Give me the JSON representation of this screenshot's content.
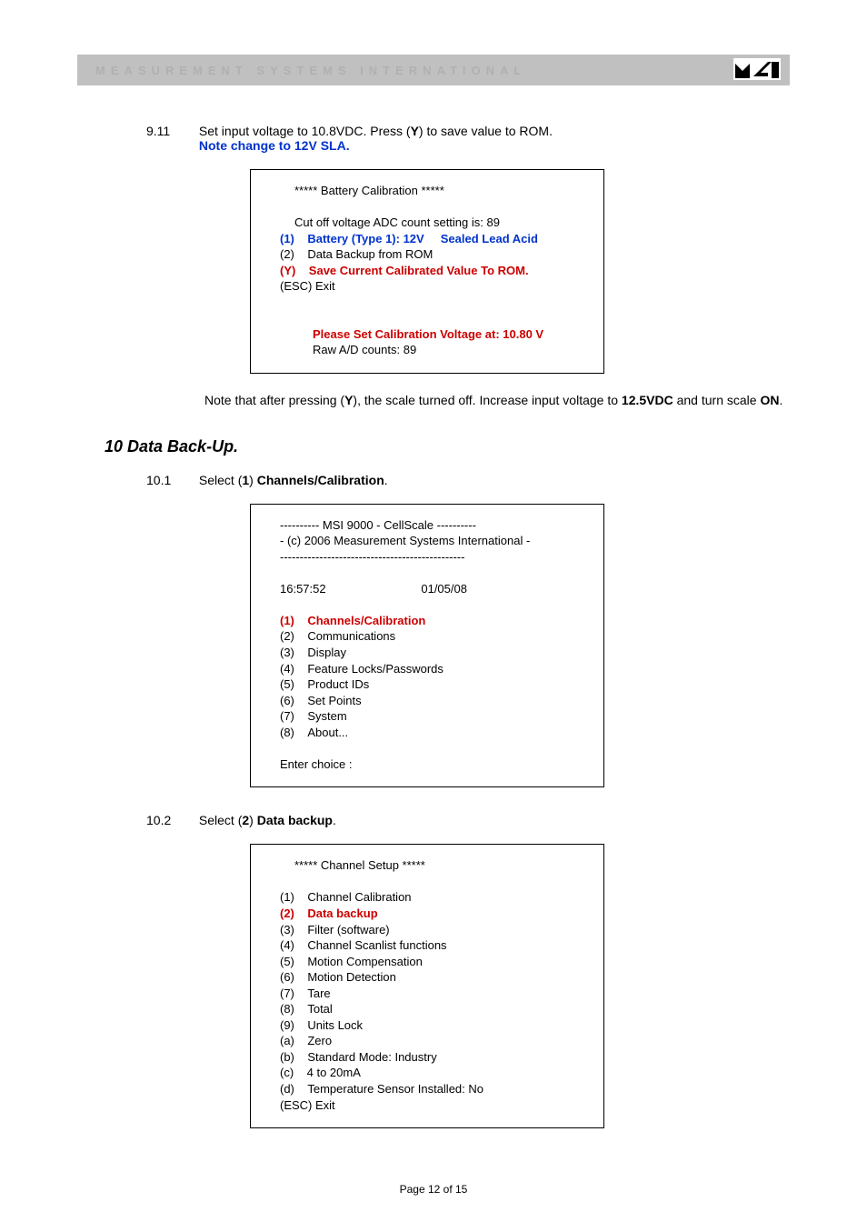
{
  "header": {
    "company": "MEASUREMENT SYSTEMS INTERNATIONAL"
  },
  "step911": {
    "num": "9.11",
    "text1": "Set input voltage to 10.8VDC. Press (",
    "text1b": "Y",
    "text1c": ") to save value to ROM.",
    "note": "Note change to 12V SLA."
  },
  "box1": {
    "title": "***** Battery Calibration *****",
    "l1": "Cut off voltage ADC count setting is: 89",
    "l2p": "(1)",
    "l2a": "Battery   (Type 1):  12V",
    "l2b": "Sealed Lead Acid",
    "l3p": "(2)",
    "l3": "Data Backup from ROM",
    "l4p": "(Y)",
    "l4": "Save Current Calibrated Value To ROM.",
    "l5": "(ESC)   Exit",
    "cal": "Please Set Calibration Voltage at: 10.80 V",
    "raw": "Raw A/D counts: 89"
  },
  "note1": {
    "a": "Note that after pressing (",
    "b": "Y",
    "c": "), the scale turned off. Increase input voltage to ",
    "d": "12.5VDC",
    "e": " and turn scale ",
    "f": "ON",
    "g": "."
  },
  "h10": "10  Data Back-Up.",
  "step101": {
    "num": "10.1",
    "a": "Select (",
    "b": "1",
    "c": ") ",
    "d": "Channels/Calibration",
    "e": "."
  },
  "box2": {
    "h1": "----------  MSI 9000  -  CellScale  ----------",
    "h2": "- (c) 2006 Measurement Systems International -",
    "h3": "-----------------------------------------------",
    "time": "16:57:52",
    "date": "01/05/08",
    "m1p": "(1)",
    "m1": "Channels/Calibration",
    "m2p": "(2)",
    "m2": "Communications",
    "m3p": "(3)",
    "m3": "Display",
    "m4p": "(4)",
    "m4": "Feature Locks/Passwords",
    "m5p": "(5)",
    "m5": "Product IDs",
    "m6p": "(6)",
    "m6": "Set Points",
    "m7p": "(7)",
    "m7": "System",
    "m8p": "(8)",
    "m8": "About...",
    "prompt": "Enter choice :"
  },
  "step102": {
    "num": "10.2",
    "a": "Select (",
    "b": "2",
    "c": ") ",
    "d": "Data backup",
    "e": "."
  },
  "box3": {
    "title": "***** Channel Setup *****",
    "r1p": "(1)",
    "r1": "Channel Calibration",
    "r2p": "(2)",
    "r2": "Data backup",
    "r3p": "(3)",
    "r3": "Filter (software)",
    "r4p": "(4)",
    "r4": "Channel Scanlist functions",
    "r5p": "(5)",
    "r5": "Motion Compensation",
    "r6p": "(6)",
    "r6": "Motion Detection",
    "r7p": "(7)",
    "r7": "Tare",
    "r8p": "(8)",
    "r8": "Total",
    "r9p": "(9)",
    "r9": "Units Lock",
    "rap": "(a)",
    "ra": "Zero",
    "rbp": "(b)",
    "rb": "Standard Mode: Industry",
    "rcp": "(c)",
    "rc": "4 to 20mA",
    "rdp": "(d)",
    "rd": "Temperature Sensor Installed: No",
    "esc": "(ESC)   Exit"
  },
  "footer": "Page 12 of 15"
}
